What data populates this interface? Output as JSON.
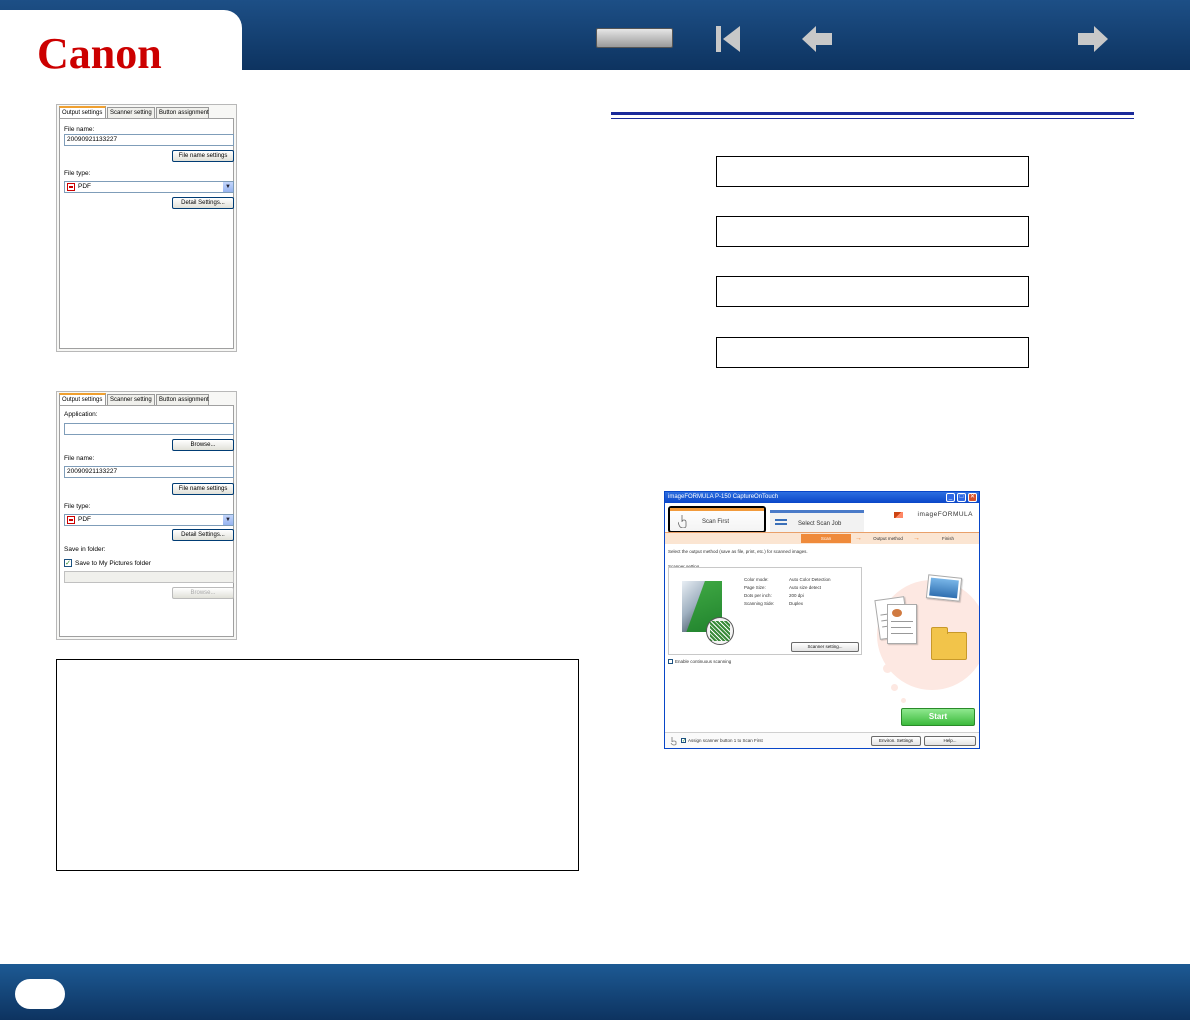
{
  "header": {
    "logo_text": "Canon",
    "nav_icons": [
      "blank-button",
      "first-page-icon",
      "previous-page-icon",
      "next-page-icon"
    ],
    "colors": {
      "bar": "#0d3360",
      "logo": "#cc0000"
    }
  },
  "panel1": {
    "tabs": [
      "Output settings",
      "Scanner setting",
      "Button assignment"
    ],
    "file_name_label": "File name:",
    "file_name_value": "20090921133227",
    "file_name_settings_btn": "File name settings",
    "file_type_label": "File type:",
    "file_type_value": "PDF",
    "detail_settings_btn": "Detail Settings..."
  },
  "panel2": {
    "tabs": [
      "Output settings",
      "Scanner setting",
      "Button assignment"
    ],
    "application_label": "Application:",
    "application_value": "",
    "browse_btn": "Browse...",
    "file_name_label": "File name:",
    "file_name_value": "20090921133227",
    "file_name_settings_btn": "File name settings",
    "file_type_label": "File type:",
    "file_type_value": "PDF",
    "detail_settings_btn": "Detail Settings...",
    "save_folder_label": "Save in folder:",
    "save_to_my_pictures": "Save to My Pictures folder",
    "save_to_my_pictures_checked": true,
    "folder_path_value": "",
    "browse_btn_2": "Browse..."
  },
  "app": {
    "title": "imageFORMULA P-150 CaptureOnTouch",
    "tab_scan_first": "Scan First",
    "tab_select_scan_job": "Select Scan Job",
    "brand": "imageFORMULA",
    "steps": [
      "Scan",
      "Output method",
      "Finish"
    ],
    "description": "Select the output method (save as file, print, etc.) for scanned images.",
    "scanner_setting_label": "Scanner setting",
    "settings": [
      {
        "key": "Color mode:",
        "value": "Auto Color Detection"
      },
      {
        "key": "Page Size:",
        "value": "Auto size detect"
      },
      {
        "key": "Dots per inch:",
        "value": "200 dpi"
      },
      {
        "key": "Scanning Side:",
        "value": "Duplex"
      }
    ],
    "scanner_setting_btn": "Scanner setting...",
    "continuous_label": "Enable continuous scanning",
    "start_btn": "Start",
    "assign_label": "Assign scanner button 1 to Scan First",
    "env_settings_btn": "Environ. Settings",
    "help_btn": "Help..."
  },
  "footer": {
    "page_number": ""
  }
}
